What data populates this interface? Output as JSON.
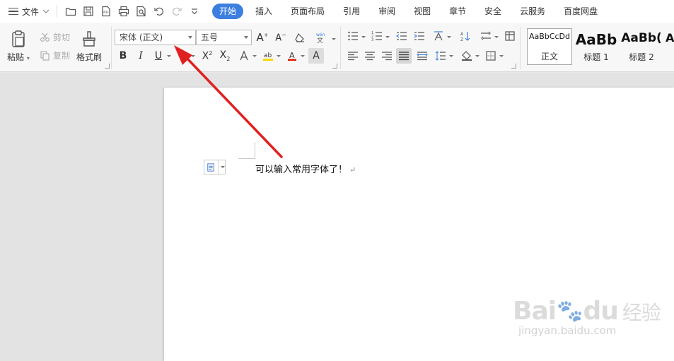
{
  "menu": {
    "file_label": "文件",
    "tabs": [
      {
        "label": "开始",
        "active": true
      },
      {
        "label": "插入"
      },
      {
        "label": "页面布局"
      },
      {
        "label": "引用"
      },
      {
        "label": "审阅"
      },
      {
        "label": "视图"
      },
      {
        "label": "章节"
      },
      {
        "label": "安全"
      },
      {
        "label": "云服务"
      },
      {
        "label": "百度网盘"
      }
    ]
  },
  "ribbon": {
    "paste_label": "粘贴",
    "cut_label": "剪切",
    "copy_label": "复制",
    "format_painter_label": "格式刷",
    "font_name": "宋体 (正文)",
    "font_size": "五号",
    "styles": [
      {
        "sample": "AaBbCcDd",
        "name": "正文"
      },
      {
        "sample": "AaBb",
        "name": "标题 1"
      },
      {
        "sample": "AaBb(",
        "name": "标题 2"
      },
      {
        "sample": "A",
        "name": ""
      }
    ]
  },
  "document": {
    "text": "可以输入常用字体了！",
    "paragraph_mark": "↵"
  },
  "watermark": {
    "logo_left": "Bai",
    "logo_right": "du",
    "logo_cn": "经验",
    "url": "jingyan.baidu.com"
  },
  "colors": {
    "accent": "#3d7fe0",
    "annotation_arrow": "#e02020",
    "highlight_yellow": "#f5d800",
    "font_color_red": "#d81e06"
  }
}
